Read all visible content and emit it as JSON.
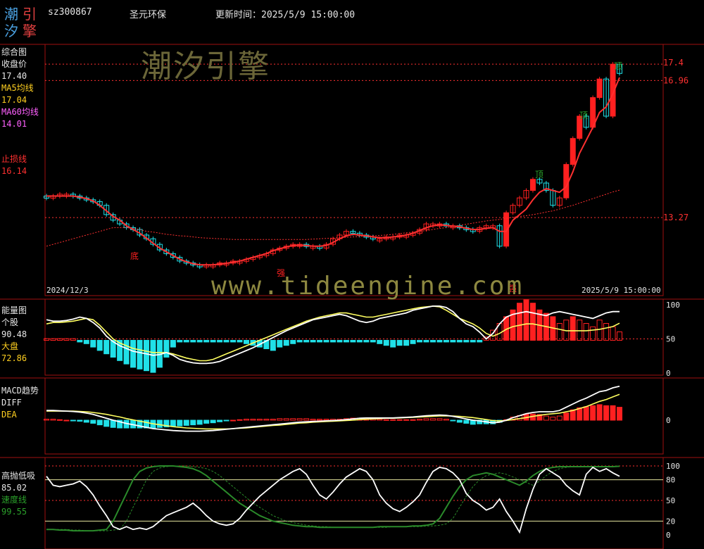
{
  "header": {
    "logo": [
      "潮",
      "引",
      "汐",
      "擎"
    ],
    "code": "sz300867",
    "name": "圣元环保",
    "time_label": "更新时间：",
    "time_value": "2025/5/9 15:00:00"
  },
  "watermarks": {
    "top": "潮汐引擎",
    "bottom": "www.tideengine.com"
  },
  "panel1": {
    "title": "综合图",
    "close_label": "收盘价",
    "close_value": "17.40",
    "ma5_label": "MA5均线",
    "ma5_value": "17.04",
    "ma60_label": "MA60均线",
    "ma60_value": "14.01",
    "stop_label": "止损线",
    "stop_value": "16.14",
    "axis": [
      "17.4",
      "16.96",
      "13.27"
    ],
    "date_start": "2024/12/3",
    "date_end": "2025/5/9 15:00:00",
    "markers": {
      "top": "顶",
      "bottom": "底",
      "strong": "强"
    }
  },
  "panel2": {
    "title": "能量图",
    "stock_label": "个股",
    "stock_value": "90.48",
    "market_label": "大盘",
    "market_value": "72.86",
    "axis": [
      "100",
      "50",
      "0"
    ]
  },
  "panel3": {
    "title": "MACD趋势",
    "diff_label": "DIFF",
    "dea_label": "DEA",
    "axis": [
      "0"
    ]
  },
  "panel4": {
    "title": "高抛低吸",
    "value1": "85.02",
    "speed_label": "速度线",
    "speed_value": "99.55",
    "axis": [
      "100",
      "80",
      "50",
      "20",
      "0"
    ]
  },
  "colors": {
    "up": "#ff2020",
    "down": "#20e0e8",
    "frame": "#a01010",
    "ma5": "#ffff60",
    "ma60": "#ff60ff",
    "stop": "#ff3030",
    "white": "#ffffff",
    "green": "#2a8a2a",
    "text": "#e6e6e6",
    "yellow": "#ffd020"
  },
  "chart_data": [
    {
      "type": "candlestick",
      "title": "综合图",
      "y_axis_labels": [
        17.4,
        16.96,
        13.27
      ],
      "close": [
        13.8,
        13.85,
        13.9,
        13.9,
        13.85,
        13.8,
        13.75,
        13.7,
        13.6,
        13.35,
        13.2,
        13.1,
        13.0,
        12.95,
        12.8,
        12.7,
        12.55,
        12.4,
        12.3,
        12.2,
        12.1,
        12.05,
        12.0,
        11.95,
        12.0,
        12.0,
        12.05,
        12.05,
        12.1,
        12.1,
        12.15,
        12.2,
        12.25,
        12.3,
        12.4,
        12.45,
        12.5,
        12.55,
        12.55,
        12.5,
        12.5,
        12.45,
        12.55,
        12.7,
        12.8,
        12.9,
        12.85,
        12.8,
        12.75,
        12.7,
        12.7,
        12.75,
        12.75,
        12.8,
        12.8,
        12.85,
        12.95,
        13.1,
        13.1,
        13.1,
        13.05,
        13.05,
        13.0,
        12.95,
        12.9,
        13.0,
        13.05,
        13.05,
        12.5,
        13.4,
        13.6,
        13.8,
        14.0,
        14.3,
        14.2,
        14.0,
        13.6,
        13.8,
        14.7,
        15.4,
        16.0,
        15.7,
        16.5,
        17.0,
        16.0,
        17.4,
        17.15
      ],
      "ma5": [
        13.85,
        13.85,
        13.85,
        13.85,
        13.85,
        13.82,
        13.78,
        13.72,
        13.6,
        13.45,
        13.3,
        13.2,
        13.05,
        12.95,
        12.85,
        12.72,
        12.58,
        12.45,
        12.35,
        12.25,
        12.15,
        12.08,
        12.03,
        12.0,
        12.0,
        12.0,
        12.02,
        12.04,
        12.07,
        12.1,
        12.15,
        12.2,
        12.25,
        12.3,
        12.38,
        12.43,
        12.48,
        12.52,
        12.53,
        12.52,
        12.5,
        12.5,
        12.52,
        12.6,
        12.7,
        12.78,
        12.82,
        12.8,
        12.78,
        12.75,
        12.73,
        12.73,
        12.75,
        12.77,
        12.8,
        12.85,
        12.92,
        13.0,
        13.05,
        13.08,
        13.06,
        13.04,
        13.02,
        12.98,
        12.95,
        12.95,
        12.98,
        13.0,
        12.9,
        12.9,
        13.2,
        13.35,
        13.5,
        13.75,
        13.95,
        14.05,
        14.0,
        13.95,
        14.1,
        14.5,
        15.0,
        15.35,
        15.7,
        16.1,
        16.25,
        16.6,
        17.04
      ],
      "ma60": [
        12.5,
        12.55,
        12.6,
        12.65,
        12.7,
        12.75,
        12.8,
        12.85,
        12.9,
        12.95,
        13.0,
        13.0,
        13.0,
        12.98,
        12.95,
        12.9,
        12.88,
        12.85,
        12.82,
        12.8,
        12.78,
        12.77,
        12.75,
        12.73,
        12.72,
        12.71,
        12.7,
        12.69,
        12.68,
        12.68,
        12.68,
        12.68,
        12.68,
        12.68,
        12.68,
        12.68,
        12.68,
        12.68,
        12.68,
        12.68,
        12.69,
        12.7,
        12.71,
        12.72,
        12.73,
        12.74,
        12.75,
        12.76,
        12.77,
        12.78,
        12.79,
        12.8,
        12.82,
        12.84,
        12.86,
        12.88,
        12.9,
        12.92,
        12.95,
        12.98,
        13.0,
        13.03,
        13.06,
        13.09,
        13.12,
        13.15,
        13.18,
        13.2,
        13.22,
        13.25,
        13.28,
        13.3,
        13.32,
        13.35,
        13.38,
        13.42,
        13.45,
        13.5,
        13.55,
        13.6,
        13.66,
        13.72,
        13.78,
        13.84,
        13.9,
        13.96,
        14.01
      ]
    },
    {
      "type": "line+bar",
      "title": "能量图",
      "series": [
        {
          "name": "个股",
          "values": [
            78,
            76,
            76,
            77,
            79,
            82,
            80,
            74,
            66,
            54,
            46,
            40,
            36,
            32,
            30,
            28,
            26,
            27,
            30,
            26,
            20,
            17,
            15,
            14,
            14,
            15,
            17,
            21,
            25,
            29,
            33,
            37,
            42,
            47,
            52,
            57,
            62,
            66,
            70,
            74,
            78,
            80,
            82,
            84,
            86,
            84,
            80,
            76,
            74,
            76,
            80,
            82,
            84,
            86,
            88,
            92,
            94,
            96,
            98,
            98,
            96,
            90,
            80,
            72,
            68,
            60,
            50,
            58,
            72,
            82,
            86,
            88,
            90,
            88,
            86,
            84,
            88,
            90,
            88,
            86,
            84,
            82,
            80,
            84,
            88,
            90,
            90
          ]
        },
        {
          "name": "大盘",
          "values": [
            72,
            74,
            74,
            75,
            76,
            78,
            80,
            78,
            70,
            60,
            50,
            44,
            40,
            36,
            34,
            32,
            30,
            30,
            30,
            28,
            25,
            22,
            20,
            18,
            18,
            20,
            24,
            28,
            32,
            36,
            40,
            44,
            48,
            52,
            56,
            60,
            64,
            68,
            72,
            76,
            79,
            82,
            84,
            86,
            88,
            88,
            86,
            84,
            82,
            82,
            84,
            86,
            88,
            90,
            92,
            94,
            96,
            97,
            98,
            97,
            92,
            86,
            80,
            76,
            72,
            66,
            58,
            54,
            58,
            64,
            68,
            70,
            72,
            72,
            70,
            68,
            66,
            64,
            62,
            62,
            62,
            62,
            63,
            64,
            66,
            68,
            73
          ]
        }
      ],
      "bars": [
        1,
        1,
        1,
        1,
        1,
        -1,
        -2,
        -4,
        -6,
        -8,
        -10,
        -12,
        -14,
        -16,
        -17,
        -18,
        -19,
        -16,
        -10,
        -4,
        -1,
        -1,
        -1,
        -1,
        -1,
        -1,
        -1,
        -1,
        -1,
        -1,
        -2,
        -3,
        -4,
        -5,
        -6,
        -4,
        -3,
        -2,
        -1,
        -1,
        -1,
        -1,
        -1,
        -1,
        -1,
        -1,
        -1,
        -1,
        -1,
        -1,
        -2,
        -3,
        -4,
        -3,
        -3,
        -2,
        -1,
        -1,
        -1,
        -1,
        -1,
        -1,
        -1,
        -1,
        -1,
        -1,
        2,
        6,
        10,
        14,
        18,
        22,
        24,
        22,
        18,
        16,
        14,
        10,
        12,
        14,
        12,
        10,
        8,
        12,
        10,
        8,
        5
      ],
      "y_axis": [
        0,
        50,
        100
      ]
    },
    {
      "type": "macd",
      "title": "MACD趋势",
      "series": [
        {
          "name": "DIFF",
          "values": [
            0.3,
            0.3,
            0.29,
            0.28,
            0.27,
            0.25,
            0.22,
            0.18,
            0.12,
            0.06,
            0.0,
            -0.05,
            -0.1,
            -0.14,
            -0.18,
            -0.22,
            -0.26,
            -0.28,
            -0.3,
            -0.32,
            -0.33,
            -0.34,
            -0.34,
            -0.34,
            -0.33,
            -0.32,
            -0.3,
            -0.28,
            -0.26,
            -0.24,
            -0.22,
            -0.2,
            -0.18,
            -0.16,
            -0.14,
            -0.12,
            -0.1,
            -0.08,
            -0.06,
            -0.05,
            -0.04,
            -0.03,
            -0.02,
            -0.01,
            0.0,
            0.02,
            0.04,
            0.06,
            0.07,
            0.07,
            0.07,
            0.07,
            0.07,
            0.08,
            0.09,
            0.1,
            0.12,
            0.14,
            0.15,
            0.16,
            0.15,
            0.12,
            0.08,
            0.04,
            0.0,
            -0.02,
            -0.05,
            -0.08,
            -0.06,
            0.0,
            0.08,
            0.14,
            0.2,
            0.24,
            0.26,
            0.26,
            0.26,
            0.3,
            0.4,
            0.5,
            0.6,
            0.68,
            0.78,
            0.88,
            0.92,
            1.0,
            1.05
          ]
        },
        {
          "name": "DEA",
          "values": [
            0.28,
            0.28,
            0.28,
            0.28,
            0.28,
            0.27,
            0.26,
            0.24,
            0.21,
            0.18,
            0.14,
            0.1,
            0.05,
            0.01,
            -0.03,
            -0.07,
            -0.11,
            -0.14,
            -0.17,
            -0.2,
            -0.22,
            -0.24,
            -0.25,
            -0.26,
            -0.27,
            -0.27,
            -0.27,
            -0.27,
            -0.26,
            -0.25,
            -0.24,
            -0.22,
            -0.2,
            -0.18,
            -0.16,
            -0.15,
            -0.13,
            -0.11,
            -0.09,
            -0.08,
            -0.06,
            -0.05,
            -0.04,
            -0.03,
            -0.02,
            -0.01,
            0.0,
            0.02,
            0.03,
            0.04,
            0.05,
            0.06,
            0.06,
            0.07,
            0.08,
            0.09,
            0.1,
            0.11,
            0.12,
            0.13,
            0.13,
            0.13,
            0.12,
            0.1,
            0.08,
            0.05,
            0.02,
            -0.01,
            -0.02,
            -0.01,
            0.02,
            0.05,
            0.08,
            0.12,
            0.15,
            0.18,
            0.2,
            0.22,
            0.26,
            0.3,
            0.36,
            0.42,
            0.5,
            0.58,
            0.64,
            0.72,
            0.8
          ]
        }
      ],
      "bars": [
        0.02,
        0.02,
        0.01,
        0.0,
        -0.01,
        -0.02,
        -0.04,
        -0.06,
        -0.09,
        -0.12,
        -0.14,
        -0.15,
        -0.15,
        -0.15,
        -0.15,
        -0.15,
        -0.15,
        -0.14,
        -0.13,
        -0.12,
        -0.11,
        -0.1,
        -0.09,
        -0.08,
        -0.06,
        -0.05,
        -0.03,
        -0.01,
        0.0,
        0.01,
        0.02,
        0.02,
        0.02,
        0.02,
        0.02,
        0.03,
        0.03,
        0.03,
        0.03,
        0.03,
        0.02,
        0.02,
        0.02,
        0.02,
        0.02,
        0.03,
        0.04,
        0.04,
        0.04,
        0.03,
        0.02,
        0.01,
        0.01,
        0.01,
        0.01,
        0.01,
        0.02,
        0.03,
        0.03,
        0.03,
        0.02,
        -0.01,
        -0.04,
        -0.06,
        -0.08,
        -0.07,
        -0.07,
        -0.07,
        -0.04,
        0.01,
        0.06,
        0.09,
        0.12,
        0.12,
        0.11,
        0.08,
        0.06,
        0.08,
        0.14,
        0.2,
        0.24,
        0.26,
        0.28,
        0.3,
        0.28,
        0.28,
        0.25
      ]
    },
    {
      "type": "line",
      "title": "高抛低吸",
      "y_axis": [
        0,
        20,
        50,
        80,
        100
      ],
      "series": [
        {
          "name": "高抛低吸",
          "values": [
            85,
            72,
            70,
            72,
            74,
            78,
            70,
            58,
            42,
            28,
            12,
            8,
            12,
            8,
            10,
            8,
            12,
            20,
            28,
            32,
            36,
            40,
            46,
            38,
            28,
            20,
            16,
            14,
            16,
            24,
            36,
            46,
            56,
            64,
            72,
            80,
            86,
            92,
            96,
            88,
            72,
            58,
            52,
            62,
            74,
            84,
            90,
            96,
            92,
            80,
            58,
            46,
            38,
            34,
            40,
            48,
            58,
            76,
            92,
            98,
            96,
            90,
            80,
            60,
            50,
            44,
            36,
            40,
            52,
            34,
            20,
            4,
            38,
            66,
            88,
            96,
            90,
            84,
            72,
            64,
            58,
            88,
            98,
            92,
            96,
            90,
            85
          ]
        },
        {
          "name": "速度线",
          "values": [
            8,
            8,
            7,
            7,
            6,
            6,
            6,
            6,
            7,
            8,
            20,
            40,
            60,
            80,
            92,
            97,
            99,
            100,
            100,
            100,
            99,
            98,
            96,
            92,
            86,
            78,
            70,
            62,
            54,
            46,
            40,
            34,
            28,
            24,
            20,
            18,
            16,
            14,
            13,
            12,
            12,
            11,
            11,
            11,
            11,
            11,
            11,
            11,
            11,
            11,
            12,
            12,
            12,
            12,
            12,
            13,
            13,
            14,
            16,
            24,
            40,
            56,
            70,
            80,
            86,
            88,
            90,
            88,
            84,
            80,
            76,
            72,
            78,
            86,
            92,
            96,
            98,
            99,
            99,
            99,
            99,
            99,
            99,
            99,
            99,
            99,
            99.55
          ]
        }
      ]
    }
  ]
}
